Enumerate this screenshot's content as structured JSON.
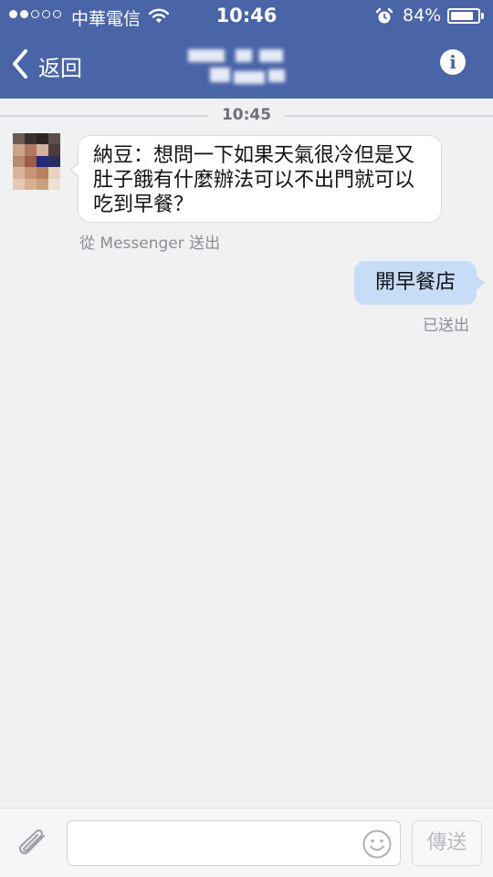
{
  "status_bar": {
    "carrier": "中華電信",
    "time": "10:46",
    "battery_percent": "84%",
    "signal_strength": 2,
    "signal_max": 5,
    "battery_level": 0.84
  },
  "nav": {
    "back_label": "返回",
    "back_icon": "chevron-left-icon",
    "info_icon": "info-icon",
    "info_glyph": "i"
  },
  "conversation": {
    "time_divider": "10:45",
    "incoming": {
      "text": "納豆：想問一下如果天氣很冷但是又肚子餓有什麼辦法可以不出門就可以吃到早餐？",
      "via": "從 Messenger 送出"
    },
    "outgoing": {
      "text": "開早餐店",
      "status": "已送出"
    }
  },
  "composer": {
    "placeholder": "",
    "send_label": "傳送",
    "attach_icon": "paperclip-icon",
    "emoji_icon": "smiley-icon"
  },
  "colors": {
    "header_bg": "#4a64a8",
    "page_bg": "#f0f1f3",
    "outgoing_bubble": "#c7dcf6",
    "incoming_bubble": "#ffffff"
  }
}
